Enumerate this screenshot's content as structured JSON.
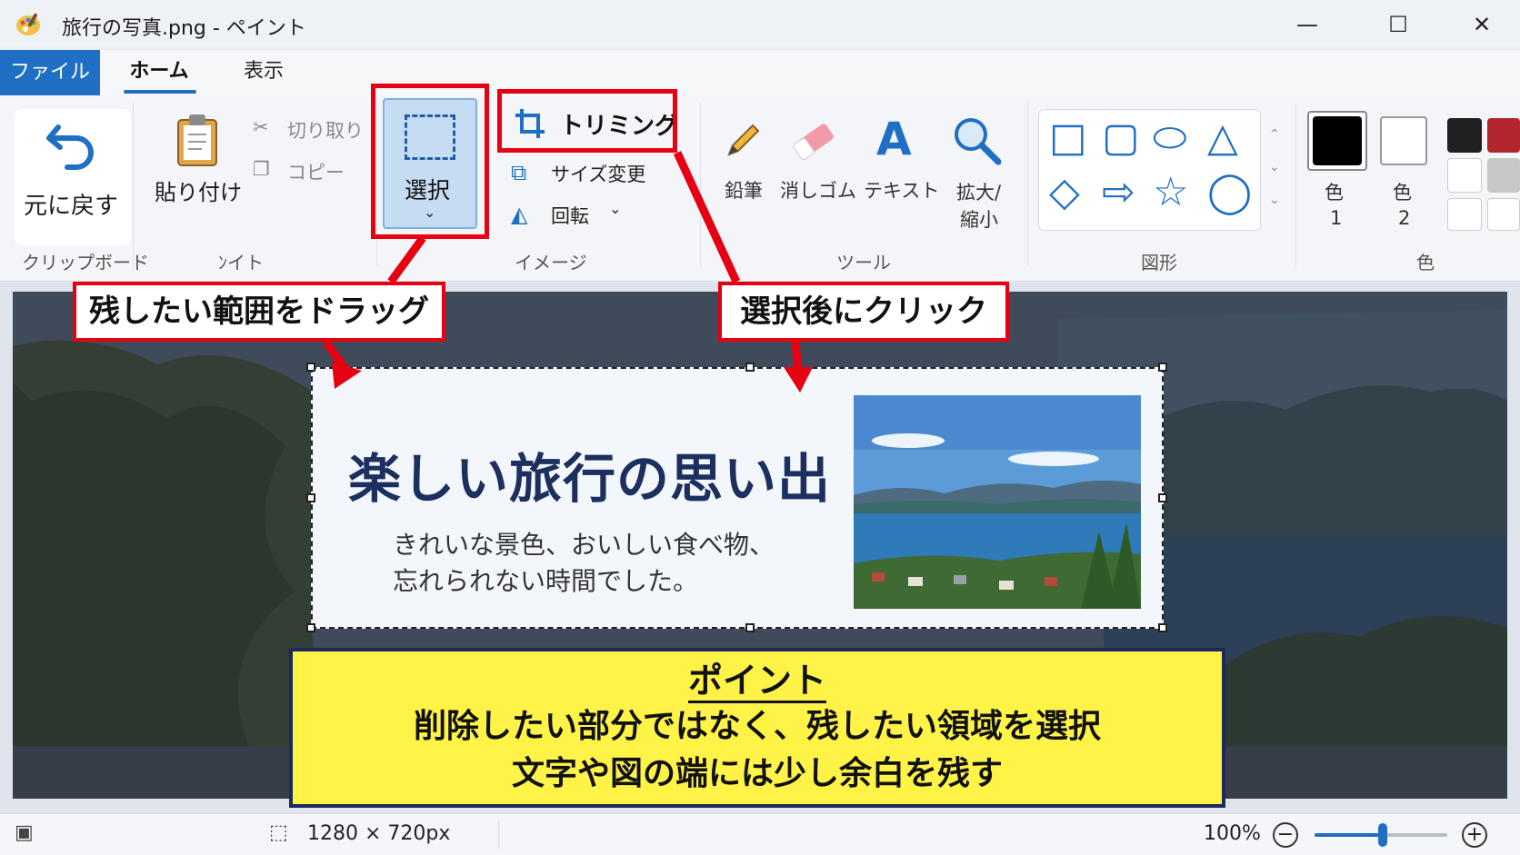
{
  "window": {
    "title": "旅行の写真.png - ペイント",
    "icon": "paint-palette-icon",
    "controls": [
      "minimize",
      "maximize",
      "close"
    ]
  },
  "menu": {
    "file": "ファイル",
    "home": "ホーム",
    "view": "表示"
  },
  "ribbon": {
    "undo": "元に戻す",
    "clipboard_group": "クリップボード",
    "paste": "貼り付け",
    "cut": "切り取り",
    "copy": "コピー",
    "select": "選択",
    "trim": "トリミング",
    "resize": "サイズ変更",
    "rotate": "回転",
    "image_group_left": "ﾝイト",
    "image_group": "イメージ",
    "pencil": "鉛筆",
    "eraser": "消しゴム",
    "text_icon_letter": "A",
    "text": "テキスト",
    "zoom_line1": "拡大/",
    "zoom_line2": "縮小",
    "tools_group": "ツール",
    "shapes_group": "図形",
    "color1_label": "色",
    "color1_num": "1",
    "color2_label": "色",
    "color2_num": "2",
    "colors_group": "色"
  },
  "colors": {
    "accent": "#1f6fc4",
    "callout_red": "#e60012",
    "point_yellow": "#fff347",
    "color1": "#000000",
    "color2": "#ffffff",
    "palette_top": [
      "#202020",
      "#b3262e"
    ]
  },
  "canvas": {
    "slide_title": "楽しい旅行の思い出",
    "slide_line1": "きれいな景色、おいしい食べ物、",
    "slide_line2": "忘れられない時間でした。"
  },
  "annotations": {
    "drag_callout": "残したい範囲をドラッグ",
    "click_callout": "選択後にクリック",
    "point_title": "ポイント",
    "point_line1": "削除したい部分ではなく、残したい領域を選択",
    "point_line2": "文字や図の端には少し余白を残す"
  },
  "status": {
    "dimensions": "1280 × 720px",
    "zoom": "100%",
    "zoom_out": "−",
    "zoom_in": "+"
  }
}
